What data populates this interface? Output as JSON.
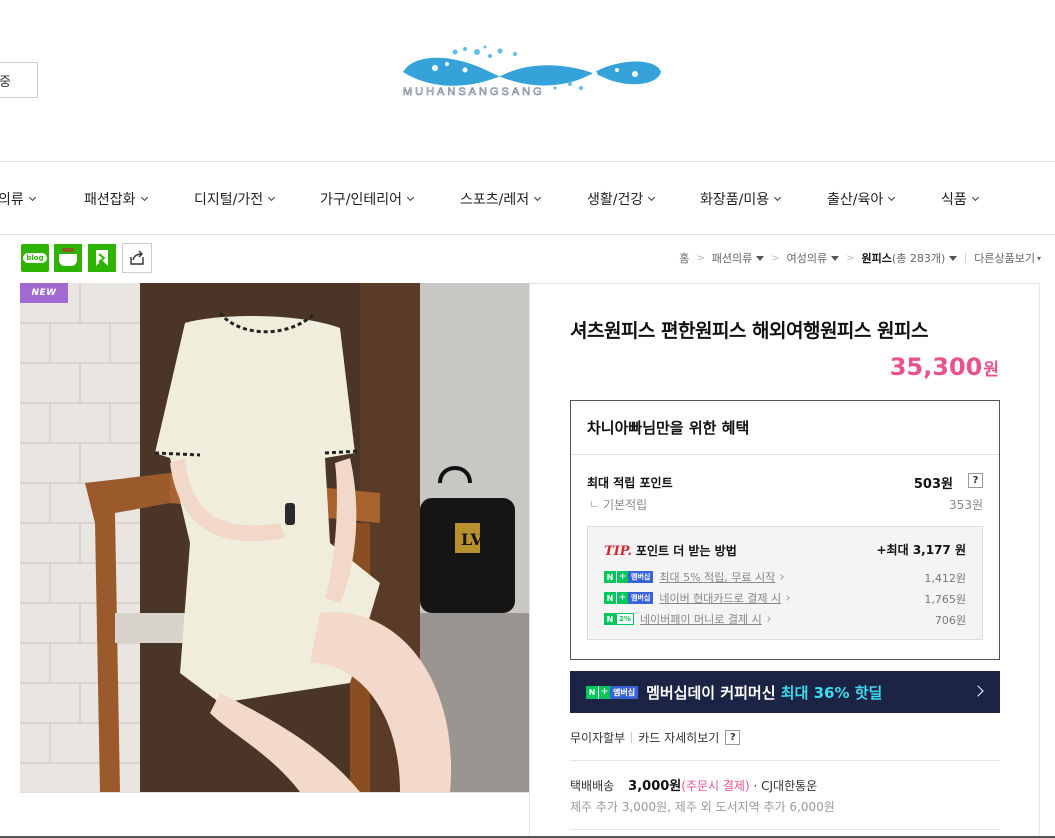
{
  "header": {
    "search_fragment": "중",
    "logo_text": "MUHANSANGSANG"
  },
  "nav": {
    "items": [
      {
        "label": "의류"
      },
      {
        "label": "패션잡화"
      },
      {
        "label": "디지털/가전"
      },
      {
        "label": "가구/인테리어"
      },
      {
        "label": "스포츠/레저"
      },
      {
        "label": "생활/건강"
      },
      {
        "label": "화장품/미용"
      },
      {
        "label": "출산/육아"
      },
      {
        "label": "식품"
      }
    ]
  },
  "share": {
    "blog_label": "blog",
    "icons": [
      "blog-icon",
      "cafe-icon",
      "band-icon",
      "share-icon"
    ]
  },
  "breadcrumb": {
    "home": "홈",
    "level1": "패션의류",
    "level2": "여성의류",
    "current": "원피스",
    "count": "(총 283개)",
    "other": "다른상품보기"
  },
  "product": {
    "badge": "NEW",
    "title": "셔츠원피스 편한원피스 해외여행원피스 원피스",
    "price": "35,300",
    "price_unit": "원",
    "accent_color": "#e8538f"
  },
  "benefit": {
    "title": "차니아빠님만을 위한 혜택",
    "max_point_label": "최대 적립 포인트",
    "max_point_value": "503원",
    "help": "?",
    "base_label": "기본적립",
    "base_value": "353원",
    "tip": {
      "tip_word": "TIP.",
      "head": "포인트 더 받는 방법",
      "max": "+최대 3,177 원",
      "rows": [
        {
          "badge_n": "N",
          "badge_plus": "+",
          "badge_mem": "멤버십",
          "text": "최대 5% 적립, 무료 시작",
          "value": "1,412원"
        },
        {
          "badge_n": "N",
          "badge_plus": "+",
          "badge_mem": "멤버십",
          "text": "네이버 현대카드로 결제 시",
          "value": "1,765원"
        },
        {
          "badge_n": "N",
          "badge_pct": "2%",
          "text": "네이버페이 머니로 결제 시",
          "value": "706원"
        }
      ]
    }
  },
  "banner": {
    "badge_n": "N",
    "badge_plus": "+",
    "badge_mem": "멤버십",
    "text": "멤버십데이 커피머신",
    "highlight": "최대 36% 핫딜"
  },
  "payment": {
    "installment": "무이자할부",
    "card_detail": "카드 자세히보기",
    "help": "?"
  },
  "shipping": {
    "label": "택배배송",
    "amount": "3,000원",
    "note": "(주문시 결제)",
    "carrier": "· CJ대한통운",
    "extra": "제주 추가 3,000원, 제주 외 도서지역 추가 6,000원"
  }
}
